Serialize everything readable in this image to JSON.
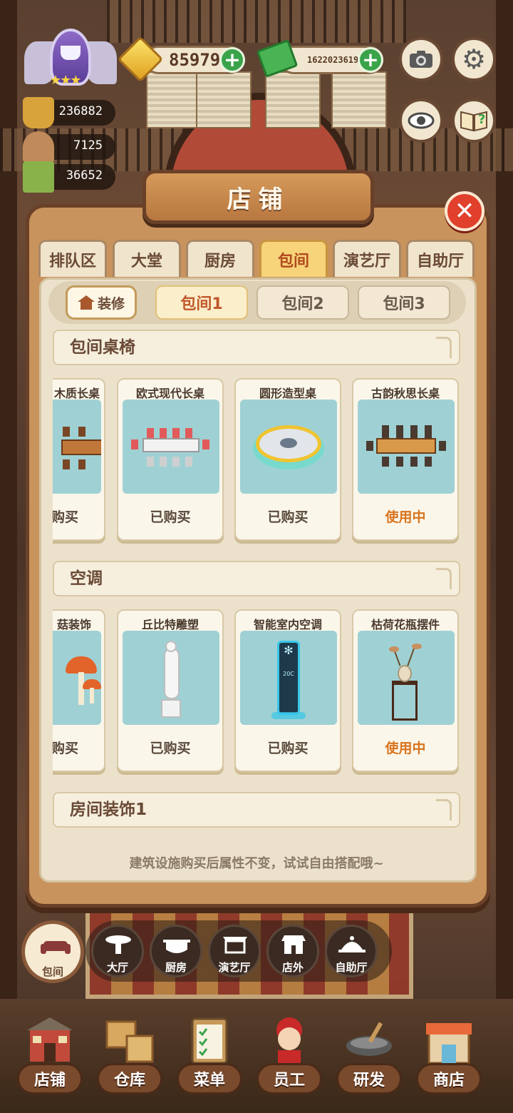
{
  "hud": {
    "gold": "85979",
    "cash": "1622023619",
    "stats": [
      "236882",
      "7125",
      "36652"
    ]
  },
  "panel": {
    "title": "店铺",
    "tabs": [
      {
        "label": "排队区",
        "active": false
      },
      {
        "label": "大堂",
        "active": false
      },
      {
        "label": "厨房",
        "active": false
      },
      {
        "label": "包间",
        "active": true
      },
      {
        "label": "演艺厅",
        "active": false
      },
      {
        "label": "自助厅",
        "active": false
      }
    ],
    "decor_label": "装修",
    "rooms": [
      {
        "label": "包间1",
        "active": true
      },
      {
        "label": "包间2",
        "active": false
      },
      {
        "label": "包间3",
        "active": false
      }
    ],
    "sections": [
      {
        "title": "包间桌椅",
        "items": [
          {
            "name": "木质长桌",
            "status": "购买"
          },
          {
            "name": "欧式现代长桌",
            "status": "已购买"
          },
          {
            "name": "圆形造型桌",
            "status": "已购买"
          },
          {
            "name": "古韵秋思长桌",
            "status": "使用中"
          }
        ]
      },
      {
        "title": "空调",
        "items": [
          {
            "name": "菇装饰",
            "status": "购买"
          },
          {
            "name": "丘比特雕塑",
            "status": "已购买"
          },
          {
            "name": "智能室内空调",
            "status": "已购买"
          },
          {
            "name": "枯荷花瓶摆件",
            "status": "使用中"
          }
        ]
      },
      {
        "title": "房间装饰1"
      }
    ],
    "ac_display": "20C",
    "footer_note": "建筑设施购买后属性不变，试试自由搭配哦~"
  },
  "room_switcher": [
    "包间",
    "大厅",
    "厨房",
    "演艺厅",
    "店外",
    "自助厅"
  ],
  "bottom_nav": [
    "店铺",
    "仓库",
    "菜单",
    "员工",
    "研发",
    "商店"
  ],
  "colors": {
    "accent": "#f7d37a",
    "in_use": "#d9741e",
    "close": "#e0402c",
    "plus": "#3aa34a",
    "panel_frame": "#c8935c"
  },
  "icons": [
    "trophy-badge-icon",
    "gold-ingot-icon",
    "cash-icon",
    "camera-icon",
    "gear-icon",
    "eye-icon",
    "help-book-icon",
    "close-icon",
    "house-icon"
  ]
}
